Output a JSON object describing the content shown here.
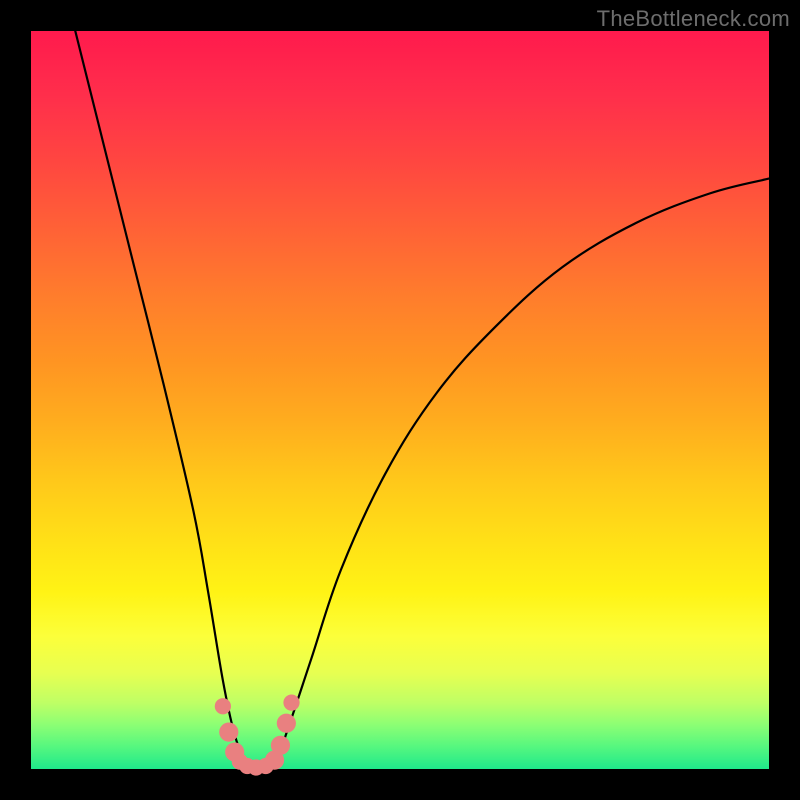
{
  "watermark": "TheBottleneck.com",
  "colors": {
    "frame": "#000000",
    "watermark": "#6d6d6d",
    "curve": "#000000",
    "marker": "#e98080"
  },
  "chart_data": {
    "type": "line",
    "title": "",
    "xlabel": "",
    "ylabel": "",
    "xlim": [
      0,
      100
    ],
    "ylim": [
      0,
      100
    ],
    "grid": false,
    "legend": false,
    "description": "Bottleneck curve over a rainbow gradient background. Y value represents bottleneck percentage (100 at top, 0 at bottom). The curve drops from top-left to a minimum near x≈30 at y≈0, then rises again toward the right edge reaching roughly y≈80.",
    "series": [
      {
        "name": "bottleneck-curve",
        "x": [
          6,
          10,
          14,
          18,
          22,
          24,
          26,
          27.5,
          29,
          30.5,
          32,
          33.5,
          35,
          38,
          42,
          48,
          55,
          63,
          72,
          82,
          92,
          100
        ],
        "y": [
          100,
          84,
          68,
          52,
          35,
          24,
          12,
          5,
          1,
          0,
          0.5,
          2,
          6,
          15,
          27,
          40,
          51,
          60,
          68,
          74,
          78,
          80
        ]
      }
    ],
    "markers": [
      {
        "x": 26.0,
        "y": 8.5,
        "r": 1.1
      },
      {
        "x": 26.8,
        "y": 5.0,
        "r": 1.3
      },
      {
        "x": 27.6,
        "y": 2.3,
        "r": 1.3
      },
      {
        "x": 28.3,
        "y": 1.0,
        "r": 1.1
      },
      {
        "x": 29.3,
        "y": 0.4,
        "r": 1.1
      },
      {
        "x": 30.5,
        "y": 0.2,
        "r": 1.1
      },
      {
        "x": 31.8,
        "y": 0.4,
        "r": 1.1
      },
      {
        "x": 33.0,
        "y": 1.2,
        "r": 1.3
      },
      {
        "x": 33.8,
        "y": 3.2,
        "r": 1.3
      },
      {
        "x": 34.6,
        "y": 6.2,
        "r": 1.3
      },
      {
        "x": 35.3,
        "y": 9.0,
        "r": 1.1
      }
    ]
  }
}
